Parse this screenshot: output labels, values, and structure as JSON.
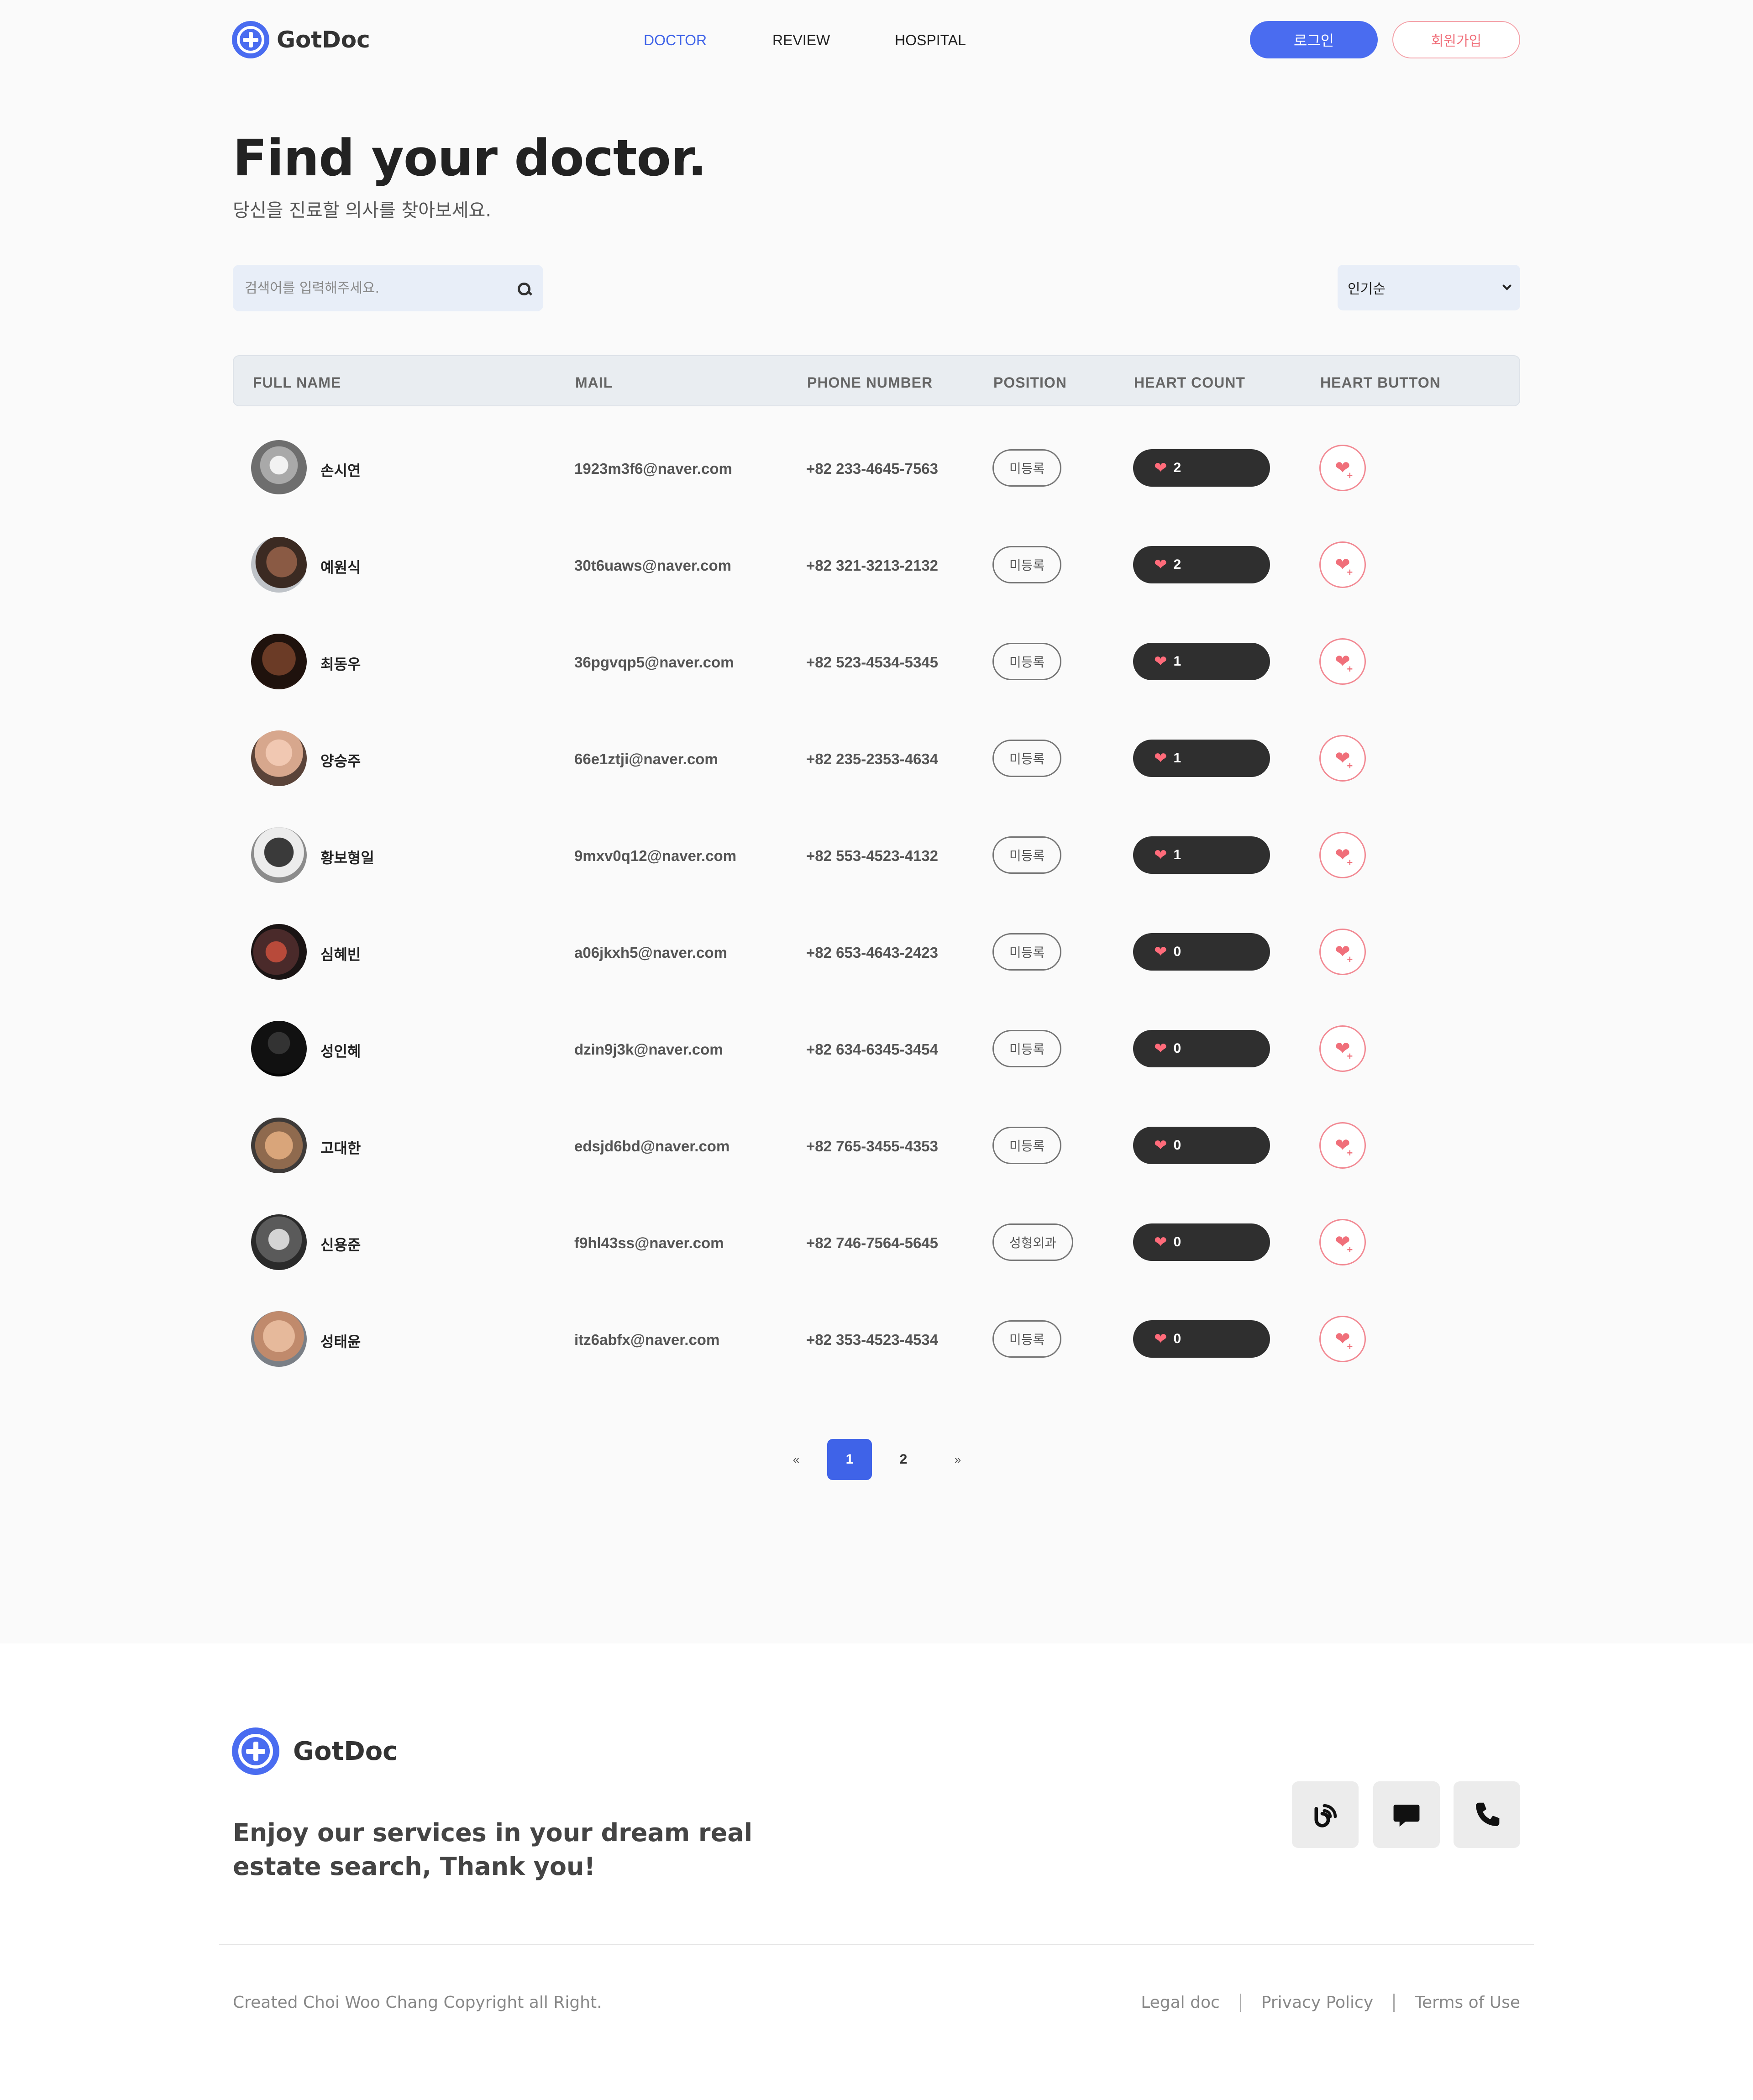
{
  "header": {
    "brand": "GotDoc",
    "nav": [
      {
        "label": "DOCTOR",
        "active": true
      },
      {
        "label": "REVIEW",
        "active": false
      },
      {
        "label": "HOSPITAL",
        "active": false
      }
    ],
    "login_label": "로그인",
    "signup_label": "회원가입"
  },
  "hero": {
    "title": "Find your doctor.",
    "subtitle": "당신을 진료할 의사를 찾아보세요."
  },
  "search": {
    "placeholder": "검색어를 입력해주세요.",
    "sort_value": "인기순"
  },
  "table": {
    "columns": [
      "FULL NAME",
      "MAIL",
      "PHONE NUMBER",
      "POSITION",
      "HEART COUNT",
      "HEART BUTTON"
    ],
    "rows": [
      {
        "name": "손시연",
        "mail": "1923m3f6@naver.com",
        "phone": "+82 233-4645-7563",
        "position": "미등록",
        "hearts": "2",
        "avatar": "cat-gray"
      },
      {
        "name": "예원식",
        "mail": "30t6uaws@naver.com",
        "phone": "+82 321-3213-2132",
        "position": "미등록",
        "hearts": "2",
        "avatar": "person-1"
      },
      {
        "name": "최동우",
        "mail": "36pgvqp5@naver.com",
        "phone": "+82 523-4534-5345",
        "position": "미등록",
        "hearts": "1",
        "avatar": "person-2"
      },
      {
        "name": "양승주",
        "mail": "66e1ztji@naver.com",
        "phone": "+82 235-2353-4634",
        "position": "미등록",
        "hearts": "1",
        "avatar": "person-3"
      },
      {
        "name": "황보형일",
        "mail": "9mxv0q12@naver.com",
        "phone": "+82 553-4523-4132",
        "position": "미등록",
        "hearts": "1",
        "avatar": "person-4"
      },
      {
        "name": "심혜빈",
        "mail": "a06jkxh5@naver.com",
        "phone": "+82 653-4643-2423",
        "position": "미등록",
        "hearts": "0",
        "avatar": "person-5"
      },
      {
        "name": "성인혜",
        "mail": "dzin9j3k@naver.com",
        "phone": "+82 634-6345-3454",
        "position": "미등록",
        "hearts": "0",
        "avatar": "person-6"
      },
      {
        "name": "고대한",
        "mail": "edsjd6bd@naver.com",
        "phone": "+82 765-3455-4353",
        "position": "미등록",
        "hearts": "0",
        "avatar": "cat-orange"
      },
      {
        "name": "신용준",
        "mail": "f9hl43ss@naver.com",
        "phone": "+82 746-7564-5645",
        "position": "성형외과",
        "hearts": "0",
        "avatar": "person-7"
      },
      {
        "name": "성태윤",
        "mail": "itz6abfx@naver.com",
        "phone": "+82 353-4523-4534",
        "position": "미등록",
        "hearts": "0",
        "avatar": "person-8"
      }
    ]
  },
  "pagination": {
    "prev": "«",
    "pages": [
      "1",
      "2"
    ],
    "current": "1",
    "next": "»"
  },
  "footer": {
    "brand": "GotDoc",
    "tagline": "Enjoy our services in your dream real estate search, Thank you!",
    "social_icons": [
      "blog-icon",
      "chat-icon",
      "phone-icon"
    ],
    "copyright": "Created Choi Woo Chang Copyright all Right.",
    "links": [
      "Legal doc",
      "Privacy Policy",
      "Terms of Use"
    ]
  },
  "colors": {
    "accent": "#4a6cf0",
    "heart": "#f06f7a",
    "dark_pill": "#2f2f2f"
  }
}
